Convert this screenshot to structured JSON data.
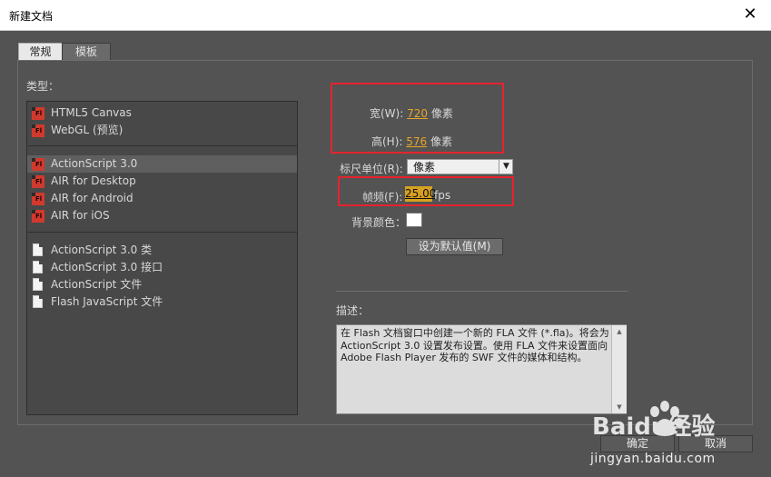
{
  "window": {
    "title": "新建文档"
  },
  "tabs": [
    {
      "label": "常规"
    },
    {
      "label": "模板"
    }
  ],
  "type_label": "类型：",
  "types": [
    {
      "label": "HTML5 Canvas",
      "icon": "fl-file-icon"
    },
    {
      "label": "WebGL (预览)",
      "icon": "fl-file-icon"
    },
    {
      "label": "ActionScript 3.0",
      "icon": "fl-file-icon",
      "selected": true
    },
    {
      "label": "AIR for Desktop",
      "icon": "fl-file-icon"
    },
    {
      "label": "AIR for Android",
      "icon": "fl-file-icon"
    },
    {
      "label": "AIR for iOS",
      "icon": "fl-file-icon"
    },
    {
      "label": "ActionScript 3.0 类",
      "icon": "script-file-icon"
    },
    {
      "label": "ActionScript 3.0 接口",
      "icon": "script-file-icon"
    },
    {
      "label": "ActionScript 文件",
      "icon": "script-file-icon"
    },
    {
      "label": "Flash JavaScript 文件",
      "icon": "script-file-icon"
    }
  ],
  "settings": {
    "width_label": "宽(W):",
    "width_value": "720",
    "height_label": "高(H):",
    "height_value": "576",
    "unit": "像素",
    "ruler_label": "标尺单位(R):",
    "ruler_value": "像素",
    "fps_label": "帧频(F):",
    "fps_value": "25.00",
    "fps_unit": "fps",
    "bg_label": "背景颜色：",
    "bg_color": "#ffffff",
    "default_button": "设为默认值(M)"
  },
  "description": {
    "label": "描述：",
    "text": "在 Flash 文档窗口中创建一个新的 FLA 文件 (*.fla)。将会为 ActionScript 3.0 设置发布设置。使用 FLA 文件来设置面向 Adobe Flash Player 发布的 SWF 文件的媒体和结构。"
  },
  "buttons": {
    "ok": "确定",
    "cancel": "取消"
  },
  "watermark": {
    "brand": "Baidu经验",
    "url": "jingyan.baidu.com"
  },
  "colors": {
    "highlight_box": "#e5232e",
    "value_accent": "#e6a42a",
    "panel_bg": "#535353"
  }
}
